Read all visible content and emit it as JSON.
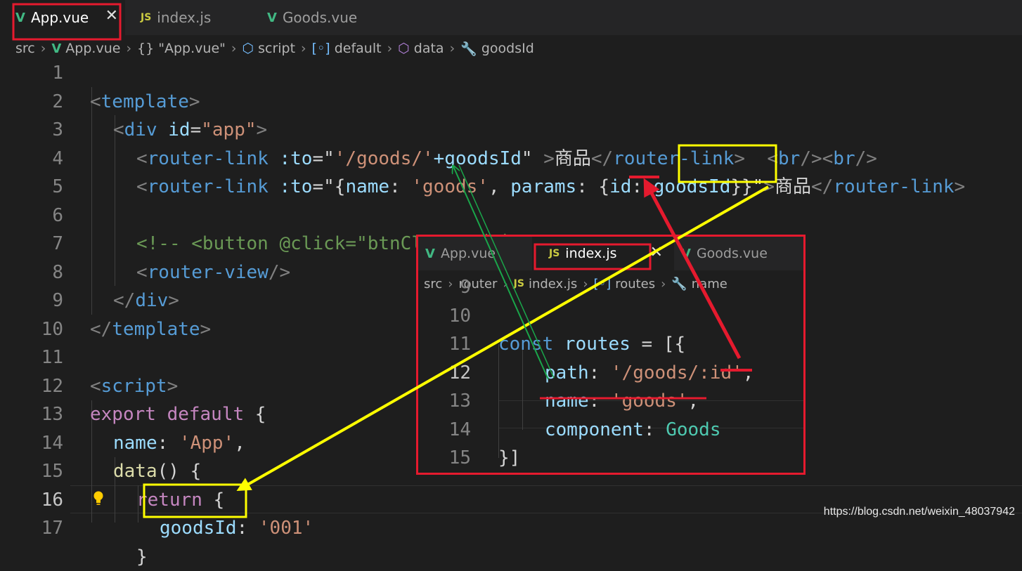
{
  "tabs": [
    {
      "label": "App.vue",
      "icon": "vue-icon",
      "active": true
    },
    {
      "label": "index.js",
      "icon": "js-icon",
      "active": false
    },
    {
      "label": "Goods.vue",
      "icon": "vue-icon",
      "active": false
    }
  ],
  "breadcrumb": {
    "items": [
      "src",
      "App.vue",
      "{} \"App.vue\"",
      "script",
      "default",
      "data",
      "goodsId"
    ]
  },
  "code": {
    "line_numbers": [
      "1",
      "2",
      "3",
      "4",
      "5",
      "6",
      "7",
      "8",
      "9",
      "10",
      "11",
      "12",
      "13",
      "14",
      "15",
      "16",
      "17"
    ],
    "current_line": "16",
    "l1": {
      "open": "<",
      "tag": "template",
      "close": ">"
    },
    "l2": {
      "open": "<",
      "tag": "div",
      "attr": "id",
      "eq": "=",
      "val": "\"app\"",
      "close": ">"
    },
    "l3": {
      "open": "<",
      "tag": "router-link",
      "attr": ":to",
      "eq": "=\"",
      "val": "'/goods/'",
      "plus": "+goodsId",
      "q": "\"",
      "close": " >",
      "text": "商品",
      "end_open": "</",
      "end_tag": "router-link",
      "end_close": ">",
      "br1_open": "  <",
      "br1": "br",
      "br1_close": "/>",
      "br2_open": "<",
      "br2": "br",
      "br2_close": "/>"
    },
    "l4": {
      "open": "<",
      "tag": "router-link",
      "attr": ":to",
      "eq": "=\"",
      "b1": "{",
      "k1": "name",
      "c1": ": ",
      "v1": "'goods'",
      "comma": ", ",
      "k2": "params",
      "c2": ": ",
      "b2": "{",
      "k3": "id",
      "c3": ": ",
      "v3": "goodsId",
      "b3": "}}",
      "q": "\"",
      "close": ">",
      "text": "商品",
      "end_open": "</",
      "end_tag": "router-link",
      "end_close": ">"
    },
    "l6": "<!-- <button @click=\"btnClick\">点击显示</button> -->",
    "l7": {
      "open": "<",
      "tag": "router-view",
      "close": "/>"
    },
    "l8": {
      "open": "</",
      "tag": "div",
      "close": ">"
    },
    "l9": {
      "open": "</",
      "tag": "template",
      "close": ">"
    },
    "l11": {
      "open": "<",
      "tag": "script",
      "close": ">"
    },
    "l12": {
      "kw": "export default",
      "brace": " {"
    },
    "l13": {
      "key": "name",
      "colon": ": ",
      "val": "'App'",
      "comma": ","
    },
    "l14": {
      "fn": "data",
      "rest": "() {"
    },
    "l15": {
      "kw": "return",
      "brace": " {"
    },
    "l16": {
      "key": "goodsId",
      "colon": ": ",
      "val": "'001'"
    },
    "l17": "}"
  },
  "inset": {
    "tabs": [
      {
        "label": "App.vue",
        "icon": "vue-icon",
        "active": false
      },
      {
        "label": "index.js",
        "icon": "js-icon",
        "active": true
      },
      {
        "label": "Goods.vue",
        "icon": "vue-icon",
        "active": false
      }
    ],
    "breadcrumb": [
      "src",
      "router",
      "index.js",
      "routes",
      "name"
    ],
    "line_numbers": [
      "9",
      "10",
      "11",
      "12",
      "13",
      "14",
      "15"
    ],
    "current_line": "12",
    "l10": {
      "kw": "const",
      "var": " routes",
      "eq": " = ",
      "br": "[{"
    },
    "l11": {
      "key": "path",
      "colon": ": ",
      "val": "'/goods/:id'",
      "comma": ","
    },
    "l12": {
      "key": "name",
      "colon": ": ",
      "val": "'goods'",
      "comma": ","
    },
    "l13": {
      "key": "component",
      "colon": ": ",
      "val": "Goods"
    },
    "l14": "}]"
  },
  "watermark": "https://blog.csdn.net/weixin_48037942",
  "colors": {
    "red_annotation": "#e51a2e",
    "yellow_annotation": "#ffff00",
    "green_annotation": "#1aa64a"
  }
}
